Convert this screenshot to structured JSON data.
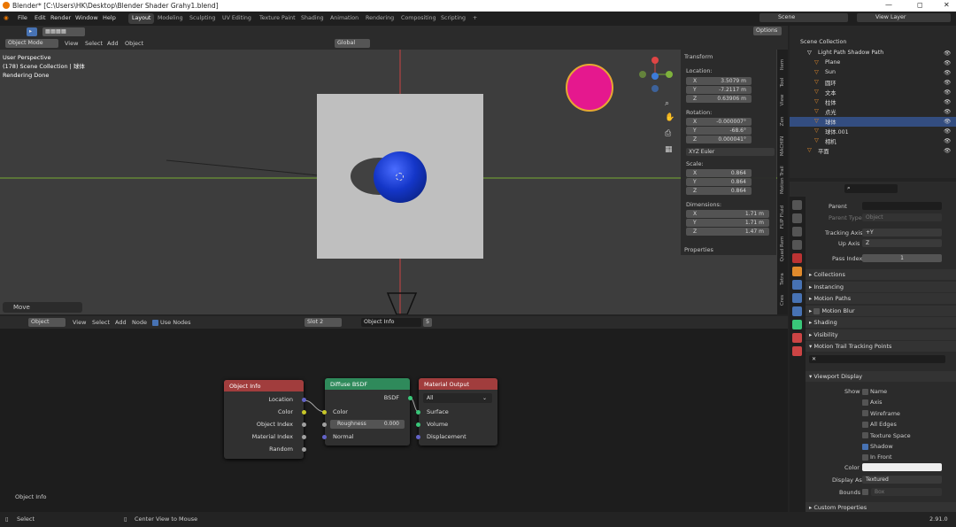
{
  "titlebar": {
    "title": "Blender* [C:\\Users\\HK\\Desktop\\Blender Shader Grahy1.blend]",
    "minimize": "—",
    "maximize": "◻",
    "close": "✕"
  },
  "menu": [
    "File",
    "Edit",
    "Render",
    "Window",
    "Help"
  ],
  "workspaces": [
    "Layout",
    "Modeling",
    "Sculpting",
    "UV Editing",
    "Texture Paint",
    "Shading",
    "Animation",
    "Rendering",
    "Compositing",
    "Scripting"
  ],
  "add_workspace": "+",
  "scene": {
    "label": "Scene",
    "view_layer": "View Layer"
  },
  "viewport_header": {
    "mode": "Object Mode",
    "items": [
      "View",
      "Select",
      "Add",
      "Object"
    ],
    "orientation": "Global",
    "options": "Options"
  },
  "overlay": {
    "line1": "User Perspective",
    "line2": "(178) Scene Collection | 球体",
    "line3": "Rendering Done"
  },
  "operator_panel": "Move",
  "transform": {
    "title": "Transform",
    "location_label": "Location:",
    "location": [
      {
        "axis": "X",
        "value": "3.5079 m"
      },
      {
        "axis": "Y",
        "value": "-7.2117 m"
      },
      {
        "axis": "Z",
        "value": "0.63906 m"
      }
    ],
    "rotation_label": "Rotation:",
    "rotation": [
      {
        "axis": "X",
        "value": "-0.000007°"
      },
      {
        "axis": "Y",
        "value": "-68.6°"
      },
      {
        "axis": "Z",
        "value": "0.000041°"
      }
    ],
    "rotation_mode": "XYZ Euler",
    "scale_label": "Scale:",
    "scale": [
      {
        "axis": "X",
        "value": "0.864"
      },
      {
        "axis": "Y",
        "value": "0.864"
      },
      {
        "axis": "Z",
        "value": "0.864"
      }
    ],
    "dimensions_label": "Dimensions:",
    "dimensions": [
      {
        "axis": "X",
        "value": "1.71 m"
      },
      {
        "axis": "Y",
        "value": "1.71 m"
      },
      {
        "axis": "Z",
        "value": "1.47 m"
      }
    ],
    "properties": "Properties"
  },
  "side_tabs": [
    "Item",
    "Tool",
    "View",
    "Zen",
    "MACHIN",
    "Motion Trail",
    "FLIP Fluid",
    "Quad Rem",
    "Tetra",
    "Cres"
  ],
  "node_header": {
    "object": "Object",
    "items": [
      "View",
      "Select",
      "Add",
      "Node"
    ],
    "use_nodes": "Use Nodes",
    "slot": "Slot 2",
    "material": "Object Info",
    "users": "5"
  },
  "nodes": {
    "object_info": {
      "title": "Object Info",
      "outputs": [
        "Location",
        "Color",
        "Object Index",
        "Material Index",
        "Random"
      ]
    },
    "diffuse": {
      "title": "Diffuse BSDF",
      "output": "BSDF",
      "inputs": [
        "Color",
        "Normal"
      ],
      "roughness_label": "Roughness",
      "roughness_value": "0.000"
    },
    "material_output": {
      "title": "Material Output",
      "target": "All",
      "inputs": [
        "Surface",
        "Volume",
        "Displacement"
      ]
    }
  },
  "node_footer": "Object Info",
  "outliner": {
    "root": "Scene Collection",
    "items": [
      {
        "name": "Light Path Shadow Path",
        "depth": 1,
        "icon": "collection-icon"
      },
      {
        "name": "Plane",
        "depth": 2,
        "icon": "mesh-icon"
      },
      {
        "name": "Sun",
        "depth": 2,
        "icon": "light-icon"
      },
      {
        "name": "圆环",
        "depth": 2,
        "icon": "mesh-icon"
      },
      {
        "name": "文本",
        "depth": 2,
        "icon": "text-icon"
      },
      {
        "name": "柱体",
        "depth": 2,
        "icon": "mesh-icon"
      },
      {
        "name": "点光",
        "depth": 2,
        "icon": "light-icon"
      },
      {
        "name": "球体",
        "depth": 2,
        "icon": "mesh-icon",
        "selected": true
      },
      {
        "name": "球体.001",
        "depth": 2,
        "icon": "mesh-icon"
      },
      {
        "name": "相机",
        "depth": 2,
        "icon": "camera-icon"
      },
      {
        "name": "平面",
        "depth": 1,
        "icon": "mesh-icon"
      }
    ]
  },
  "properties": {
    "parent_label": "Parent",
    "parent_type_label": "Parent Type",
    "parent_type": "Object",
    "tracking_axis_label": "Tracking Axis",
    "tracking_axis": "+Y",
    "up_axis_label": "Up Axis",
    "up_axis": "Z",
    "pass_index_label": "Pass Index",
    "pass_index": "1",
    "sections": [
      "Collections",
      "Instancing",
      "Motion Paths",
      "Motion Blur",
      "Shading",
      "Visibility",
      "Motion Trail Tracking Points"
    ],
    "viewport_display": "Viewport Display",
    "show_label": "Show",
    "show_options": [
      {
        "label": "Name",
        "checked": false
      },
      {
        "label": "Axis",
        "checked": false
      },
      {
        "label": "Wireframe",
        "checked": false
      },
      {
        "label": "All Edges",
        "checked": false
      },
      {
        "label": "Texture Space",
        "checked": false
      },
      {
        "label": "Shadow",
        "checked": true
      },
      {
        "label": "In Front",
        "checked": false
      }
    ],
    "color_label": "Color",
    "display_as_label": "Display As",
    "display_as": "Textured",
    "bounds_label": "Bounds",
    "bounds": "Box",
    "custom_props": "Custom Properties"
  },
  "status": {
    "select": "Select",
    "center": "Center View to Mouse",
    "version": "2.91.0"
  },
  "colors": {
    "accent": "#4772b3",
    "object_info_header": "#a13d3d",
    "diffuse_header": "#2f8a5b",
    "output_header": "#a13d3d",
    "sphere": "#1436c8",
    "grid_x": "#c44",
    "grid_y": "#7a3"
  }
}
